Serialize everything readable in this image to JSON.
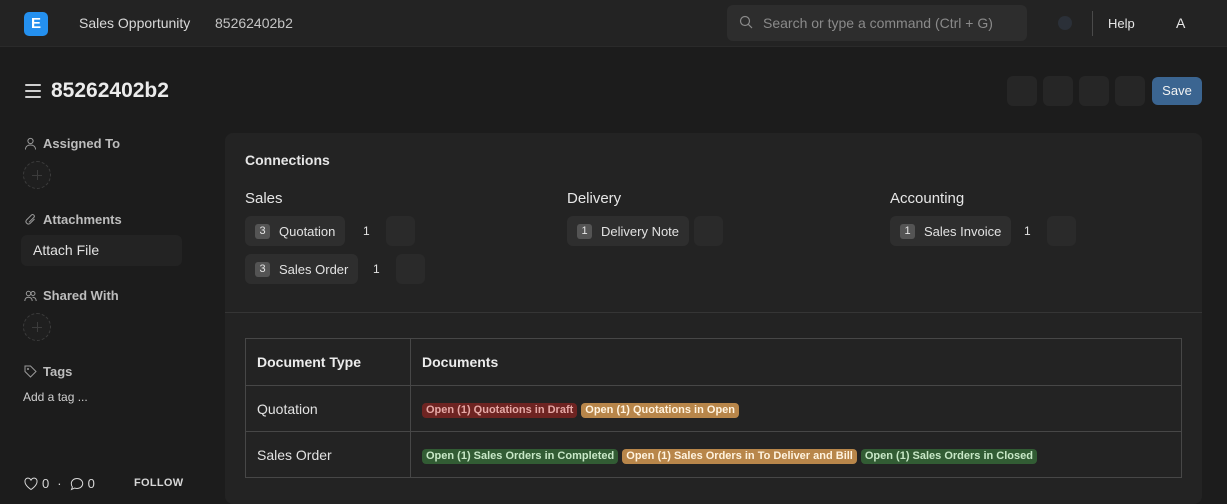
{
  "navbar": {
    "logo": "E",
    "breadcrumbs": [
      "Sales Opportunity",
      "85262402b2"
    ],
    "search_placeholder": "Search or type a command (Ctrl + G)",
    "help": "Help",
    "avatar_initial": "A"
  },
  "page": {
    "title": "85262402b2",
    "save_label": "Save"
  },
  "sidebar": {
    "assigned_to": "Assigned To",
    "attachments": "Attachments",
    "attach_file": "Attach File",
    "shared_with": "Shared With",
    "tags": "Tags",
    "add_tag": "Add a tag ...",
    "likes_count": "0",
    "comments_count": "0",
    "separator": "·",
    "follow": "FOLLOW"
  },
  "connections": {
    "title": "Connections",
    "groups": [
      {
        "title": "Sales",
        "items": [
          {
            "count": "3",
            "label": "Quotation",
            "open": "1"
          },
          {
            "count": "3",
            "label": "Sales Order",
            "open": "1"
          }
        ]
      },
      {
        "title": "Delivery",
        "items": [
          {
            "count": "1",
            "label": "Delivery Note",
            "open": ""
          }
        ]
      },
      {
        "title": "Accounting",
        "items": [
          {
            "count": "1",
            "label": "Sales Invoice",
            "open": "1"
          }
        ]
      }
    ]
  },
  "docs_table": {
    "headers": [
      "Document Type",
      "Documents"
    ],
    "rows": [
      {
        "type": "Quotation",
        "badges": [
          {
            "text": "Open (1) Quotations in Draft",
            "color": "#6e2422"
          },
          {
            "text": "Open (1) Quotations in Open",
            "color": "#b8864a"
          }
        ]
      },
      {
        "type": "Sales Order",
        "badges": [
          {
            "text": "Open (1) Sales Orders in Completed",
            "color": "#325c34"
          },
          {
            "text": "Open (1) Sales Orders in To Deliver and Bill",
            "color": "#b8864a"
          },
          {
            "text": "Open (1) Sales Orders in Closed",
            "color": "#325c34"
          }
        ]
      }
    ]
  },
  "colors": {
    "background": "#1c1c1c",
    "primary_button": "#3b6591",
    "logo": "#2490ef"
  }
}
